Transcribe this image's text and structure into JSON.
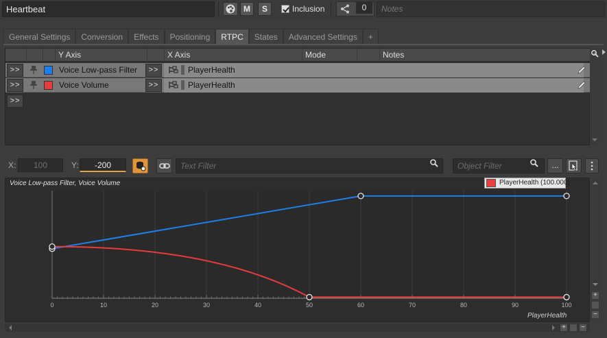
{
  "header": {
    "object_name": "Heartbeat",
    "mute_label": "M",
    "solo_label": "S",
    "inclusion_label": "Inclusion",
    "inclusion_checked": true,
    "share_count": "0",
    "notes_placeholder": "Notes"
  },
  "tabs": [
    {
      "label": "General Settings",
      "active": false
    },
    {
      "label": "Conversion",
      "active": false
    },
    {
      "label": "Effects",
      "active": false
    },
    {
      "label": "Positioning",
      "active": false
    },
    {
      "label": "RTPC",
      "active": true
    },
    {
      "label": "States",
      "active": false
    },
    {
      "label": "Advanced Settings",
      "active": false
    },
    {
      "label": "+",
      "active": false
    }
  ],
  "rtpc_table": {
    "columns": [
      "Y Axis",
      "X Axis",
      "Mode",
      "Notes"
    ],
    "expand_label": ">>",
    "rows": [
      {
        "y_axis": "Voice Low-pass Filter",
        "color": "#1a7ff0",
        "x_axis": "PlayerHealth"
      },
      {
        "y_axis": "Voice Volume",
        "color": "#e83c3c",
        "x_axis": "PlayerHealth"
      }
    ]
  },
  "filter_bar": {
    "x_label": "X:",
    "x_value": "100",
    "y_label": "Y:",
    "y_value": "-200",
    "text_filter_placeholder": "Text Filter",
    "object_filter_placeholder": "Object Filter",
    "more_label": "..."
  },
  "graph": {
    "title": "Voice Low-pass Filter, Voice Volume",
    "legend_label": "PlayerHealth (100.000)",
    "x_axis_name": "PlayerHealth",
    "x_ticks": [
      "0",
      "10",
      "20",
      "30",
      "40",
      "50",
      "60",
      "70",
      "80",
      "90",
      "100"
    ]
  },
  "chart_data": {
    "type": "line",
    "x_name": "PlayerHealth",
    "xlim": [
      0,
      100
    ],
    "series": [
      {
        "name": "Voice Low-pass Filter",
        "color": "#1f7fe8",
        "points": [
          [
            0,
            0.46
          ],
          [
            60,
            0.95
          ],
          [
            100,
            0.95
          ]
        ],
        "curve": "linear"
      },
      {
        "name": "Voice Volume",
        "color": "#e83c3c",
        "points": [
          [
            0,
            0.48
          ],
          [
            50,
            0.01
          ],
          [
            100,
            0.01
          ]
        ],
        "curve": "ease-in"
      }
    ],
    "grid": true,
    "legend": "top-right"
  },
  "colors": {
    "accent": "#e0953a",
    "lpf_curve": "#1f7fe8",
    "volume_curve": "#e83c3c"
  }
}
